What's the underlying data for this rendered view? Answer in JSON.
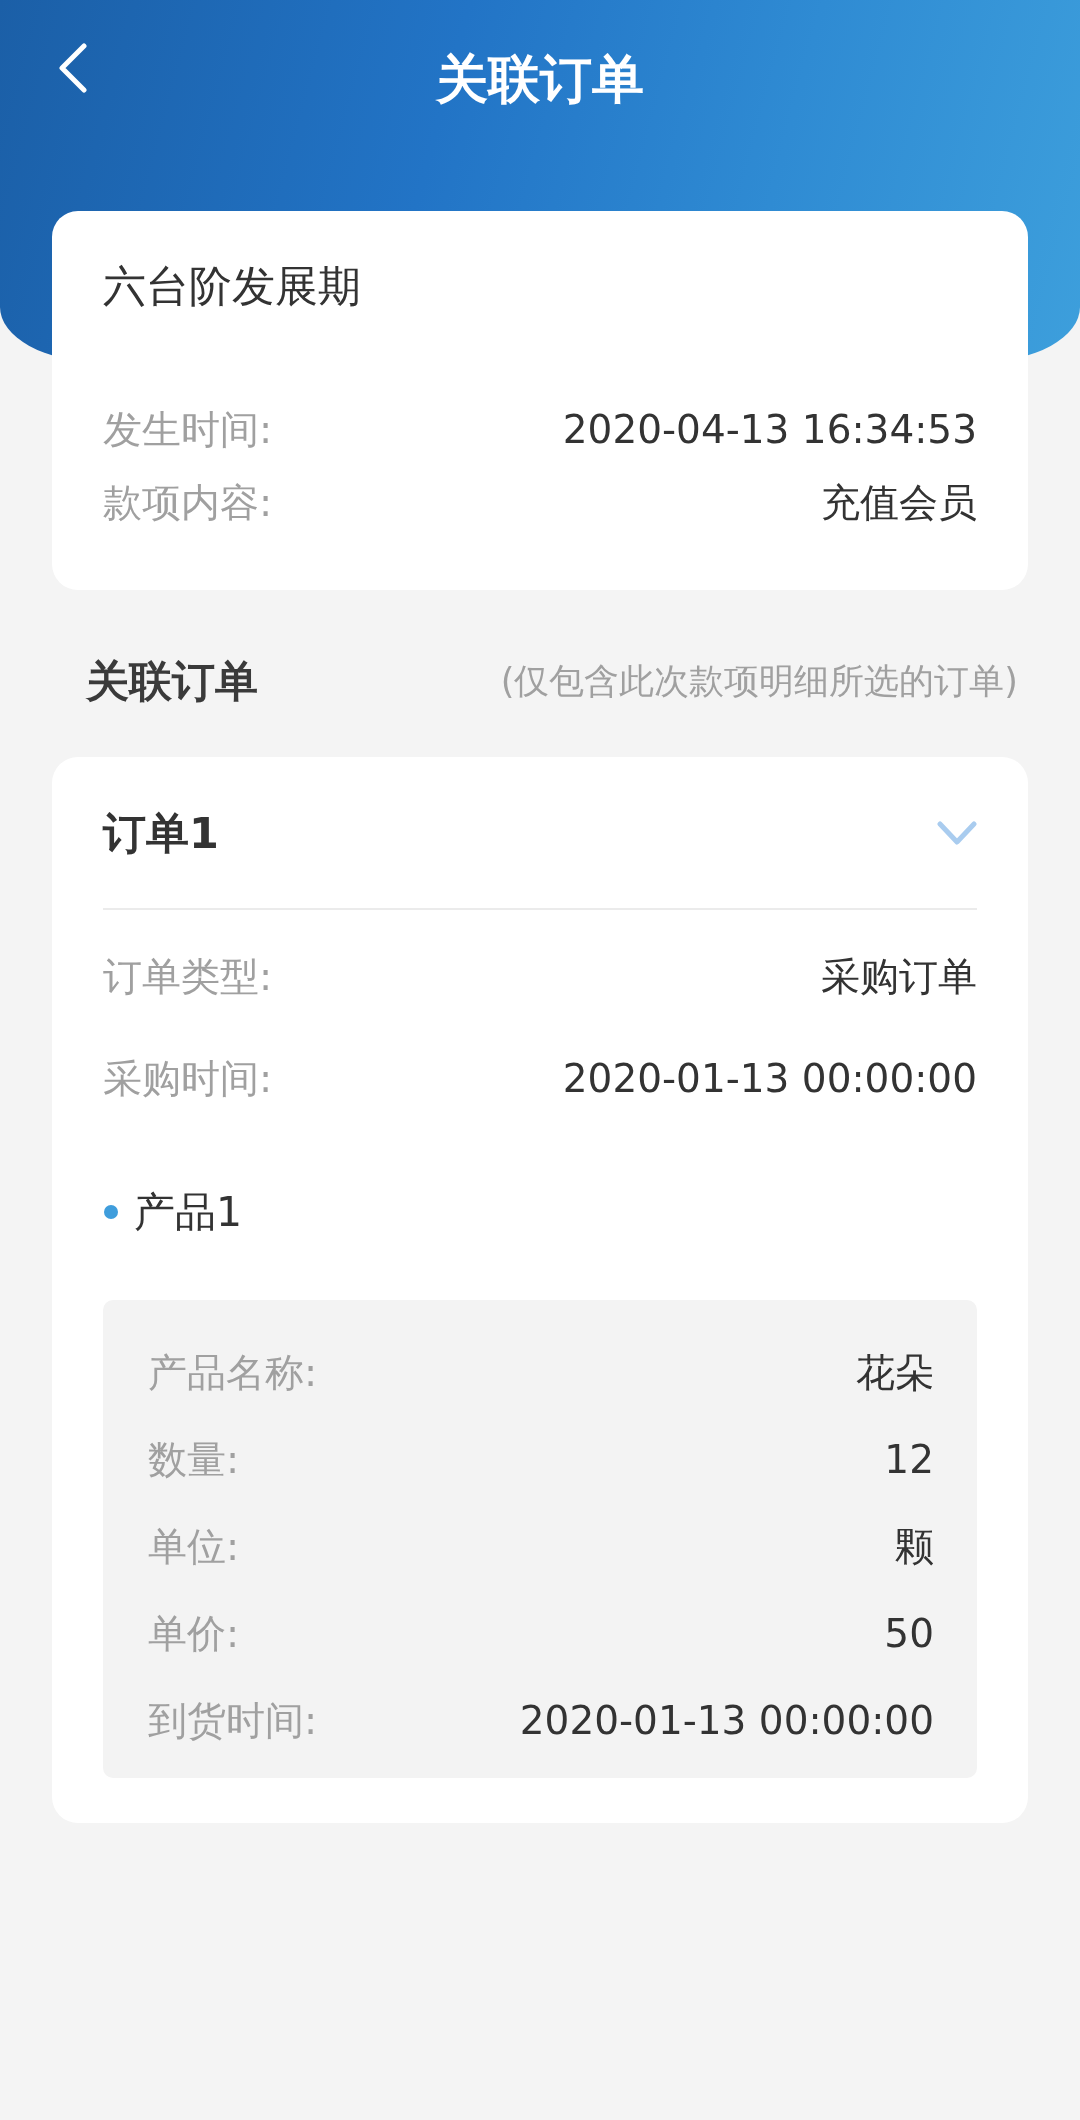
{
  "header": {
    "title": "关联订单"
  },
  "summary": {
    "title": "六台阶发展期",
    "fields": [
      {
        "label": "发生时间:",
        "value": "2020-04-13 16:34:53"
      },
      {
        "label": "款项内容:",
        "value": "充值会员"
      }
    ]
  },
  "section": {
    "title": "关联订单",
    "note": "(仅包含此次款项明细所选的订单)"
  },
  "orders": [
    {
      "title": "订单1",
      "expanded": true,
      "fields": [
        {
          "label": "订单类型:",
          "value": "采购订单"
        },
        {
          "label": "采购时间:",
          "value": "2020-01-13 00:00:00"
        }
      ],
      "products": [
        {
          "title": "产品1",
          "fields": [
            {
              "label": "产品名称:",
              "value": "花朵"
            },
            {
              "label": "数量:",
              "value": "12"
            },
            {
              "label": "单位:",
              "value": "颗"
            },
            {
              "label": "单价:",
              "value": "50"
            },
            {
              "label": "到货时间:",
              "value": "2020-01-13 00:00:00"
            }
          ]
        }
      ]
    }
  ]
}
